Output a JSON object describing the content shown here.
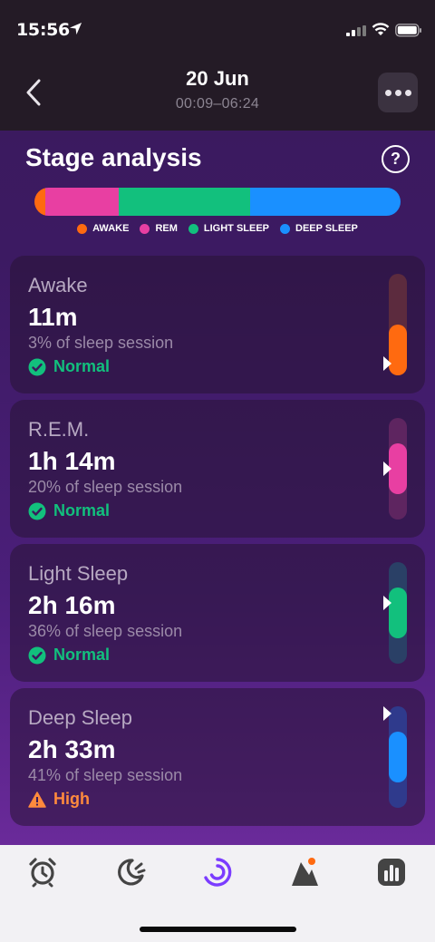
{
  "status_bar": {
    "time": "15:56",
    "icons": [
      "location-arrow-icon",
      "cellular-signal-icon",
      "wifi-icon",
      "battery-icon"
    ]
  },
  "header": {
    "title": "20 Jun",
    "subtitle": "00:09–06:24",
    "back_icon": "chevron-left-icon",
    "more_icon": "more-dots-icon"
  },
  "section": {
    "title": "Stage analysis",
    "help_label": "?"
  },
  "stage_bar": [
    {
      "name": "AWAKE",
      "fraction": 0.03,
      "color": "#ff6a10"
    },
    {
      "name": "REM",
      "fraction": 0.2,
      "color": "#e83fa2"
    },
    {
      "name": "LIGHT SLEEP",
      "fraction": 0.36,
      "color": "#12c07d"
    },
    {
      "name": "DEEP SLEEP",
      "fraction": 0.41,
      "color": "#1a90ff"
    }
  ],
  "legend": [
    {
      "label": "AWAKE",
      "color": "#ff6a10"
    },
    {
      "label": "REM",
      "color": "#e83fa2"
    },
    {
      "label": "LIGHT SLEEP",
      "color": "#12c07d"
    },
    {
      "label": "DEEP SLEEP",
      "color": "#1a90ff"
    }
  ],
  "cards": [
    {
      "name": "Awake",
      "value": "11m",
      "percent_text": "3% of sleep session",
      "status": "Normal",
      "status_type": "normal",
      "color": "#ff6a10",
      "track_color": "#5c2b3e",
      "range_fraction": [
        0.0,
        0.5
      ],
      "marker_fraction": 0.12
    },
    {
      "name": "R.E.M.",
      "value": "1h 14m",
      "percent_text": "20% of sleep session",
      "status": "Normal",
      "status_type": "normal",
      "color": "#e83fa2",
      "track_color": "#5e2560",
      "range_fraction": [
        0.25,
        0.75
      ],
      "marker_fraction": 0.5
    },
    {
      "name": "Light Sleep",
      "value": "2h 16m",
      "percent_text": "36% of sleep session",
      "status": "Normal",
      "status_type": "normal",
      "color": "#12c07d",
      "track_color": "#2a4066",
      "range_fraction": [
        0.25,
        0.75
      ],
      "marker_fraction": 0.6
    },
    {
      "name": "Deep Sleep",
      "value": "2h 33m",
      "percent_text": "41% of sleep session",
      "status": "High",
      "status_type": "warning",
      "color": "#1a90ff",
      "track_color": "#2f3a8c",
      "range_fraction": [
        0.25,
        0.75
      ],
      "marker_fraction": 1.0
    }
  ],
  "status_colors": {
    "normal": "#12c07d",
    "warning": "#ff8a3d"
  },
  "tabs": [
    {
      "name": "alarm-clock-icon",
      "active": false
    },
    {
      "name": "sleep-moon-icon",
      "active": false
    },
    {
      "name": "sleep-session-icon",
      "active": true
    },
    {
      "name": "insights-icon",
      "active": false,
      "badge": true
    },
    {
      "name": "statistics-icon",
      "active": false
    }
  ],
  "accent_color": "#7b3cff"
}
